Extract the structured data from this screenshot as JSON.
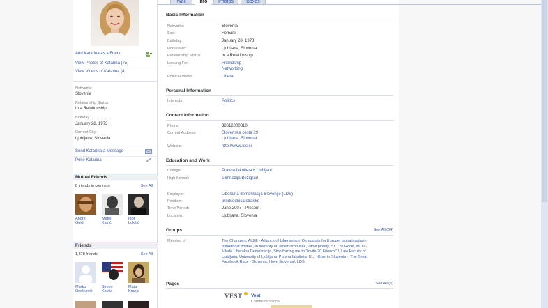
{
  "tabs": [
    {
      "label": "Wall"
    },
    {
      "label": "Info"
    },
    {
      "label": "Photos"
    },
    {
      "label": "Boxes"
    }
  ],
  "sidebar": {
    "actions": [
      "Add Katarina as a Friend",
      "View Photos of Katarina (75)",
      "View Videos of Katarina (4)"
    ],
    "info": [
      {
        "label": "Networks:",
        "value": "Slovenia"
      },
      {
        "label": "Relationship Status:",
        "value": "In a Relationship"
      },
      {
        "label": "Birthday:",
        "value": "January 28, 1973"
      },
      {
        "label": "Current City:",
        "value": "Ljubljana, Slovenia"
      }
    ],
    "contact_actions": [
      "Send Katarina a Message",
      "Poke Katarina"
    ],
    "mutual": {
      "title": "Mutual Friends",
      "count": "8 friends in common",
      "see_all": "See All",
      "people": [
        {
          "first": "Andrej",
          "last": "Guid"
        },
        {
          "first": "Matej",
          "last": "Klanč"
        },
        {
          "first": "Igor",
          "last": "Lukšič"
        }
      ]
    },
    "friends": {
      "title": "Friends",
      "count": "1,379 friends",
      "see_all": "See All",
      "people": [
        {
          "first": "Marko",
          "last": "Orešković"
        },
        {
          "first": "Simon",
          "last": "Kovše"
        },
        {
          "first": "Maja",
          "last": "Kranjc"
        }
      ]
    }
  },
  "main": {
    "basic": {
      "title": "Basic Information",
      "rows": [
        {
          "key": "Networks:",
          "value": "Slovenia"
        },
        {
          "key": "Sex:",
          "value": "Female"
        },
        {
          "key": "Birthday:",
          "value": "January 28, 1973"
        },
        {
          "key": "Hometown:",
          "value": "Ljubljana, Slovenia"
        },
        {
          "key": "Relationship Status:",
          "value": "In a Relationship"
        },
        {
          "key": "Looking For:",
          "value": "Friendship",
          "value2": "Networking"
        },
        {
          "key": "Political Views:",
          "value": "Liberal"
        }
      ]
    },
    "personal": {
      "title": "Personal Information",
      "rows": [
        {
          "key": "Interests:",
          "value": "Politics"
        }
      ]
    },
    "contact": {
      "title": "Contact Information",
      "rows": [
        {
          "key": "Phone:",
          "value": "38612000310"
        },
        {
          "key": "Current Address:",
          "value": "Slovenska cesta 29",
          "value2": "Ljubljana, Slovenia"
        },
        {
          "key": "Website:",
          "value": "http://www.lds.si"
        }
      ]
    },
    "education": {
      "title": "Education and Work",
      "rows": [
        {
          "key": "College:",
          "value": "Pravna fakulteta v Ljubljani"
        },
        {
          "key": "High School:",
          "value": "Gimnazija Bežigrad"
        },
        {
          "key": "Employer:",
          "value": "Liberalna demokracija Slovenije (LDS)"
        },
        {
          "key": "Position:",
          "value": "predsednica stranke"
        },
        {
          "key": "Time Period:",
          "value": "June 2007 - Present"
        },
        {
          "key": "Location:",
          "value": "Ljubljana, Slovenia"
        }
      ]
    },
    "groups": {
      "title": "Groups",
      "see_all": "See All (34)",
      "key": "Member of:",
      "text": "The Changers, ALDE - Alliance of Liberals and Democrats for Europe, globalizacija in prihodnost politike, In memory of Janez Drnovšek, Titovi pionirji, SIL, Yu Rock!, MLD - Mlada Liberalna Demokracija, Stop forcing me to \"Invite 20 Friends\"!!, Law Faculty of Ljubljana, University of Ljubljana, Pravna fakulteta, UL, ~Born in Slovenia~, The Great Facebook Race - Slovenia, I love Slovenia!, LDS"
    },
    "pages": {
      "title": "Pages",
      "see_all": "See All (5)",
      "item": {
        "logo": "VEST",
        "name": "Vest",
        "category": "Communications"
      }
    }
  },
  "colors": {
    "link": "#3b5998",
    "tab": "#d8dfea",
    "border": "#b7c3dc"
  }
}
